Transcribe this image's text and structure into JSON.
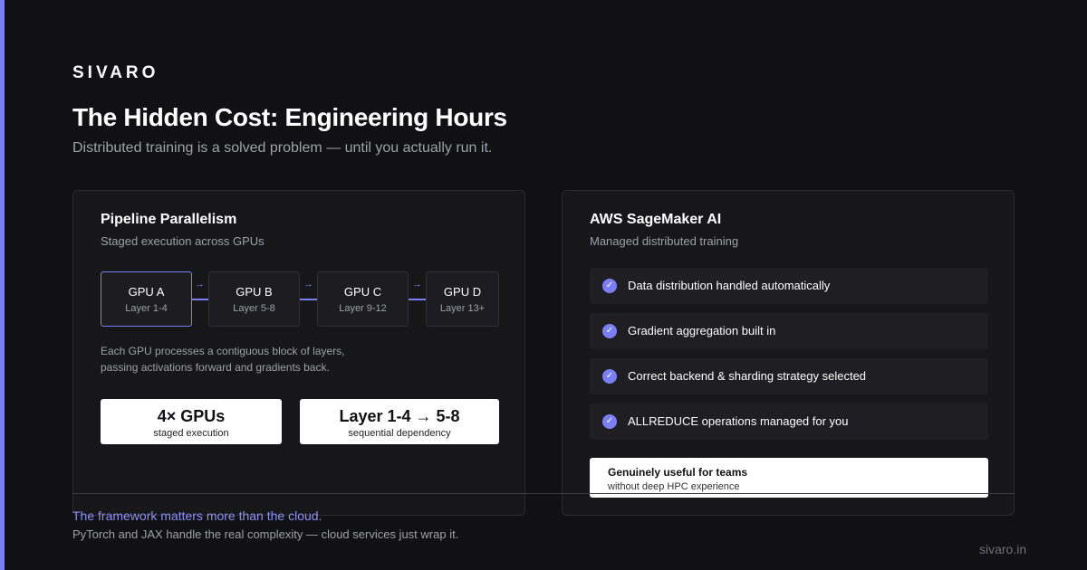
{
  "brand": "SIVARO",
  "title": "The Hidden Cost: Engineering Hours",
  "subtitle": "Distributed training is a solved problem — until you actually run it.",
  "colors": {
    "accent": "#7b7ff5",
    "background": "#111113",
    "card": "#17171a"
  },
  "left_card": {
    "title": "Pipeline Parallelism",
    "subtitle": "Staged execution across GPUs",
    "arrow_glyph": "→",
    "gpus": [
      {
        "name": "GPU A",
        "layers": "Layer 1-4"
      },
      {
        "name": "GPU B",
        "layers": "Layer 5-8"
      },
      {
        "name": "GPU C",
        "layers": "Layer 9-12"
      },
      {
        "name": "GPU D",
        "layers": "Layer 13+"
      }
    ],
    "description": [
      "Each GPU processes a contiguous block of layers,",
      "passing activations forward and gradients back."
    ],
    "stats": [
      {
        "value": "4× GPUs",
        "label": "staged execution"
      },
      {
        "value": "Layer 1-4 → 5-8",
        "label": "sequential dependency"
      }
    ]
  },
  "right_card": {
    "title": "AWS SageMaker AI",
    "subtitle": "Managed distributed training",
    "check_glyph": "✓",
    "features": [
      "Data distribution handled automatically",
      "Gradient aggregation built in",
      "Correct backend & sharding strategy selected",
      "ALLREDUCE operations managed for you"
    ],
    "callout": {
      "title": "Genuinely useful for teams",
      "subtitle": "without deep HPC experience"
    }
  },
  "footer": {
    "highlight": "The framework matters more than the cloud.",
    "note": "PyTorch and JAX handle the real complexity — cloud services just wrap it.",
    "site": "sivaro.in"
  }
}
